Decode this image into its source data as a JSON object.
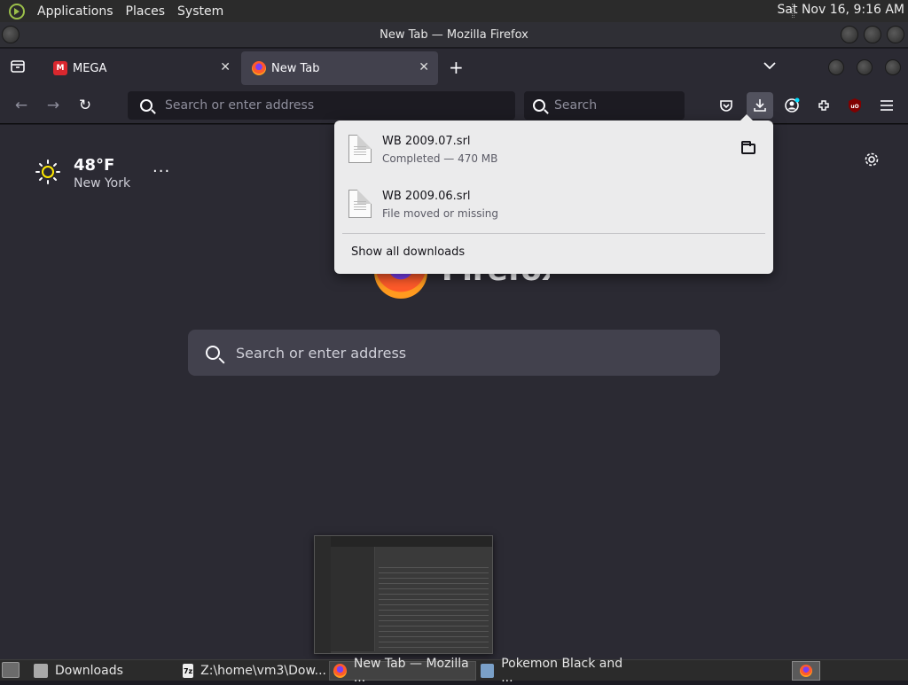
{
  "top_panel": {
    "menus": [
      "Applications",
      "Places",
      "System"
    ],
    "clock": "Sat Nov 16,  9:16 AM"
  },
  "window": {
    "title": "New Tab — Mozilla Firefox"
  },
  "tabs": [
    {
      "label": "MEGA",
      "favicon": "mega-icon"
    },
    {
      "label": "New Tab",
      "favicon": "firefox-icon",
      "active": true
    }
  ],
  "navbar": {
    "url_placeholder": "Search or enter address",
    "search_placeholder": "Search"
  },
  "new_tab": {
    "weather": {
      "temp": "48°F",
      "city": "New York",
      "more": "···"
    },
    "brand_word": "Firefox",
    "search_placeholder": "Search or enter address"
  },
  "downloads": {
    "items": [
      {
        "name": "WB 2009.07.srl",
        "status": "Completed — 470 MB",
        "has_folder": true
      },
      {
        "name": "WB 2009.06.srl",
        "status": "File moved or missing",
        "has_folder": false
      }
    ],
    "show_all": "Show all downloads"
  },
  "taskbar": {
    "items": [
      {
        "label": "Downloads",
        "icon": "folder-icon"
      },
      {
        "label": "Z:\\home\\vm3\\Dow...",
        "icon": "7zip-icon"
      },
      {
        "label": "New Tab — Mozilla ...",
        "icon": "firefox-icon",
        "active": true
      },
      {
        "label": "Pokemon Black and ...",
        "icon": "wine-icon"
      }
    ]
  },
  "colors": {
    "accent": "#0df",
    "window_bg": "#2b2a33",
    "panel_bg": "#ebebec"
  }
}
